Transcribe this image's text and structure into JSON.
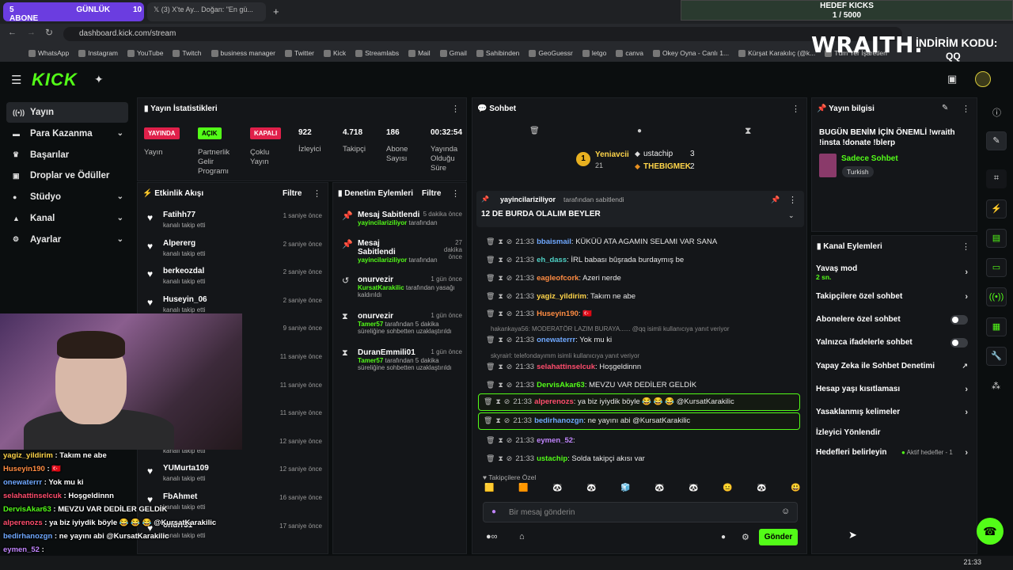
{
  "browser": {
    "tab1_title": "GÜNLÜK ABONE",
    "tab1_count_left": "5",
    "tab1_count_right": "10",
    "tab2_title": "(3) X'te Ay... Doğan: \"En gü...",
    "url": "dashboard.kick.com/stream",
    "bookmarks": [
      "WhatsApp",
      "Instagram",
      "YouTube",
      "Twitch",
      "business manager",
      "Twitter",
      "Kick",
      "Streamlabs",
      "Mail",
      "Gmail",
      "Sahibinden",
      "GeoGuessr",
      "letgo",
      "canva",
      "Okey Oyna - Canlı 1...",
      "Kürşat Karakılıç (@k...",
      "Tüm Yer İşaretleri"
    ]
  },
  "overlay": {
    "hedef_title": "HEDEF KICKS",
    "hedef_value": "1 / 5000",
    "wraith_logo": "WRAITH.",
    "indirim_label": "İNDİRİM KODU:",
    "indirim_code": "QQ"
  },
  "sidebar": {
    "items": [
      {
        "label": "Yayın",
        "icon": "broadcast-icon",
        "active": true
      },
      {
        "label": "Para Kazanma",
        "icon": "money-icon",
        "chevron": true
      },
      {
        "label": "Başarılar",
        "icon": "trophy-icon"
      },
      {
        "label": "Droplar ve Ödüller",
        "icon": "gift-icon"
      },
      {
        "label": "Stüdyo",
        "icon": "studio-icon",
        "chevron": true
      },
      {
        "label": "Kanal",
        "icon": "channel-icon",
        "chevron": true
      },
      {
        "label": "Ayarlar",
        "icon": "gear-icon",
        "chevron": true
      }
    ]
  },
  "stats": {
    "title": "Yayın İstatistikleri",
    "yayinda_tag": "YAYINDA",
    "yayinda_label": "Yayın",
    "acik_tag": "AÇIK",
    "acik_label": "Partnerlik Gelir Programı",
    "kapali_tag": "KAPALI",
    "kapali_label": "Çoklu Yayın",
    "viewers": "922",
    "viewers_label": "İzleyici",
    "followers": "4.718",
    "followers_label": "Takipçi",
    "subs": "186",
    "subs_label": "Abone Sayısı",
    "duration": "00:32:54",
    "duration_label": "Yayında Olduğu Süre"
  },
  "activity": {
    "title": "Etkinlik Akışı",
    "filter": "Filtre",
    "events": [
      {
        "name": "Fatihh77",
        "sub": "kanalı takip etti",
        "time": "1 saniye önce"
      },
      {
        "name": "Alpererg",
        "sub": "kanalı takip etti",
        "time": "2 saniye önce"
      },
      {
        "name": "berkeozdal",
        "sub": "kanalı takip etti",
        "time": "2 saniye önce"
      },
      {
        "name": "Huseyin_06",
        "sub": "kanalı takip etti",
        "time": "2 saniye önce"
      },
      {
        "name": "",
        "sub": "",
        "time": "9 saniye önce"
      },
      {
        "name": "",
        "sub": "",
        "time": "11 saniye önce"
      },
      {
        "name": "",
        "sub": "",
        "time": "11 saniye önce"
      },
      {
        "name": "",
        "sub": "",
        "time": "11 saniye önce"
      },
      {
        "name": "",
        "sub": "kanalı takip etti",
        "time": "12 saniye önce"
      },
      {
        "name": "YUMurta109",
        "sub": "kanalı takip etti",
        "time": "12 saniye önce"
      },
      {
        "name": "FbAhmet",
        "sub": "kanalı takip etti",
        "time": "16 saniye önce"
      },
      {
        "name": "onurr31",
        "sub": "kanalı takip etti",
        "time": "17 saniye önce"
      }
    ]
  },
  "moderation": {
    "title": "Denetim Eylemleri",
    "filter": "Filtre",
    "items": [
      {
        "name": "Mesaj Sabitlendi",
        "by_user": "yayincilariziliyor",
        "by_rest": " tarafından",
        "time": "5 dakika önce"
      },
      {
        "name": "Mesaj Sabitlendi",
        "by_user": "yayincilariziliyor",
        "by_rest": " tarafından",
        "time": "27 dakika önce"
      },
      {
        "name": "onurvezir",
        "by_user": "KursatKarakilic",
        "by_rest": " tarafından yasağı kaldırıldı",
        "time": "1 gün önce"
      },
      {
        "name": "onurvezir",
        "by_user": "Tamer57",
        "by_rest": " tarafından 5 dakika süreliğine sohbetten uzaklaştırıldı",
        "time": "1 gün önce"
      },
      {
        "name": "DuranEmmili01",
        "by_user": "Tamer57",
        "by_rest": " tarafından 5 dakika süreliğine sohbetten uzaklaştırıldı",
        "time": "1 gün önce"
      }
    ]
  },
  "chat": {
    "title": "Sohbet",
    "leaders": [
      {
        "name": "Yeniavcii",
        "count": "21",
        "rank": "1"
      },
      {
        "name": "ustachip",
        "count": "3"
      },
      {
        "name": "THEBIGMEK",
        "count": "2"
      }
    ],
    "pinned_user": "yayincilariziliyor",
    "pinned_by": "tarafından sabitlendi",
    "pinned_text": "12 DE BURDA OLALIM BEYLER",
    "messages": [
      {
        "time": "21:33",
        "user": "bbaismail",
        "color": "#6fa8ff",
        "text": ": KÜKÜÜ ATA AGAMIN SELAMI VAR SANA"
      },
      {
        "time": "21:33",
        "user": "eh_dass",
        "color": "#4fd1c5",
        "text": ": İRL babası bûşrada burdaymış be"
      },
      {
        "time": "21:33",
        "user": "eagleofcork",
        "color": "#ff8c42",
        "text": ": Azeri nerde"
      },
      {
        "time": "21:33",
        "user": "yagiz_yildirim",
        "color": "#ffd54a",
        "text": ": Takım ne abe"
      },
      {
        "time": "21:33",
        "user": "Huseyin190",
        "color": "#ff8c42",
        "text": ": 🇹🇷"
      },
      {
        "time": "21:33",
        "user": "onewaterrr",
        "color": "#6fa8ff",
        "text": ": Yok mu ki"
      },
      {
        "time": "21:33",
        "user": "selahattinselcuk",
        "color": "#ff4d6d",
        "text": ": Hoşgeldinnn"
      },
      {
        "time": "21:33",
        "user": "DervisAkar63",
        "color": "#53fc18",
        "text": ": MEVZU VAR DEDİLER GELDİK"
      },
      {
        "time": "21:33",
        "user": "alperenozs",
        "color": "#ff4d6d",
        "text": ": ya biz iyiydik böyle 😂 😂 😂 @KursatKarakilic"
      },
      {
        "time": "21:33",
        "user": "bedirhanozgn",
        "color": "#6fa8ff",
        "text": ": ne yayını abi @KursatKarakilic"
      },
      {
        "time": "21:33",
        "user": "eymen_52",
        "color": "#c084fc",
        "text": ":"
      },
      {
        "time": "21:33",
        "user": "ustachip",
        "color": "#53fc18",
        "text": ": Solda takipçi akısı var"
      }
    ],
    "reply1": "hakankaya56: MODERATÖR LAZIM BURAYA...... @qq isimli kullanıcıya yanıt veriyor",
    "reply2": "skyrairl: telefondayımm isimli kullanıcıya yanıt veriyor",
    "followers_only": "Takipçilere Özel",
    "input_placeholder": "Bir mesaj gönderin",
    "send": "Gönder"
  },
  "info": {
    "title": "Yayın bilgisi",
    "stream_title": "BUGÜN BENİM İÇİN ÖNEMLİ !wraith !insta !donate !blerp",
    "category": "Sadece Sohbet",
    "language": "Turkish"
  },
  "actions": {
    "title": "Kanal Eylemleri",
    "items": [
      {
        "label": "Yavaş mod",
        "sub": "2 sn.",
        "type": "arrow"
      },
      {
        "label": "Takipçilere özel sohbet",
        "type": "arrow"
      },
      {
        "label": "Abonelere özel sohbet",
        "type": "toggle"
      },
      {
        "label": "Yalnızca ifadelerle sohbet",
        "type": "toggle"
      },
      {
        "label": "Yapay Zeka ile Sohbet Denetimi",
        "type": "external"
      },
      {
        "label": "Hesap yaşı kısıtlaması",
        "type": "arrow"
      },
      {
        "label": "Yasaklanmış kelimeler",
        "type": "arrow"
      },
      {
        "label": "İzleyici Yönlendir",
        "type": "none"
      },
      {
        "label": "Hedefleri belirleyin",
        "extra": "Aktif hedefler - 1",
        "type": "arrow"
      }
    ]
  },
  "overlay_chat": [
    {
      "user": "yagiz_yildirim",
      "color": "#ffd54a",
      "text": " : Takım ne abe"
    },
    {
      "user": "Huseyin190",
      "color": "#ff8c42",
      "text": " : 🇹🇷"
    },
    {
      "user": "onewaterrr",
      "color": "#6fa8ff",
      "text": " : Yok mu ki"
    },
    {
      "user": "selahattinselcuk",
      "color": "#ff4d6d",
      "text": " : Hoşgeldinnn"
    },
    {
      "user": "DervisAkar63",
      "color": "#53fc18",
      "text": " : MEVZU VAR DEDİLER GELDİK"
    },
    {
      "user": "alperenozs",
      "color": "#ff4d6d",
      "text": " : ya biz iyiydik böyle 😂 😂 😂 @KursatKarakilic"
    },
    {
      "user": "bedirhanozgn",
      "color": "#6fa8ff",
      "text": " : ne yayını abi @KursatKarakilic"
    },
    {
      "user": "eymen_52",
      "color": "#c084fc",
      "text": " :"
    },
    {
      "user": "ustachip",
      "color": "#53fc18",
      "text": " : Solda takipçi akısı var"
    }
  ],
  "taskbar": {
    "clock": "21:33"
  },
  "colors": {
    "kick_green": "#53fc18",
    "bg": "#0b0e0f",
    "panel": "#141619"
  }
}
